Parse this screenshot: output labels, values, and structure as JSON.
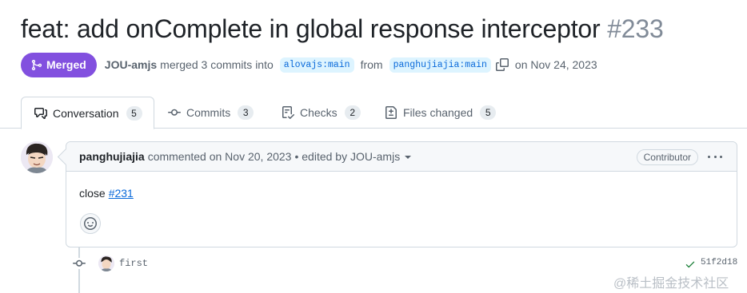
{
  "pr": {
    "title": "feat: add onComplete in global response interceptor",
    "number": "#233",
    "status": "Merged",
    "author": "JOU-amjs",
    "merged_text": "merged 3 commits into",
    "base_branch": "alovajs:main",
    "from_text": "from",
    "head_branch": "panghujiajia:main",
    "date_text": "on Nov 24, 2023"
  },
  "tabs": [
    {
      "label": "Conversation",
      "count": "5",
      "icon": "comment-discussion-icon"
    },
    {
      "label": "Commits",
      "count": "3",
      "icon": "git-commit-icon"
    },
    {
      "label": "Checks",
      "count": "2",
      "icon": "checklist-icon"
    },
    {
      "label": "Files changed",
      "count": "5",
      "icon": "file-diff-icon"
    }
  ],
  "comment": {
    "user": "panghujiajia",
    "action": "commented on Nov 20, 2023",
    "edited": "• edited by JOU-amjs",
    "role": "Contributor",
    "body_text": "close",
    "body_link": "#231"
  },
  "commit": {
    "message": "first",
    "sha": "51f2d18"
  },
  "watermark": "@稀土掘金技术社区",
  "colors": {
    "merged": "#8250df",
    "link": "#0969da",
    "success": "#1a7f37",
    "border": "#d1d9e0"
  }
}
